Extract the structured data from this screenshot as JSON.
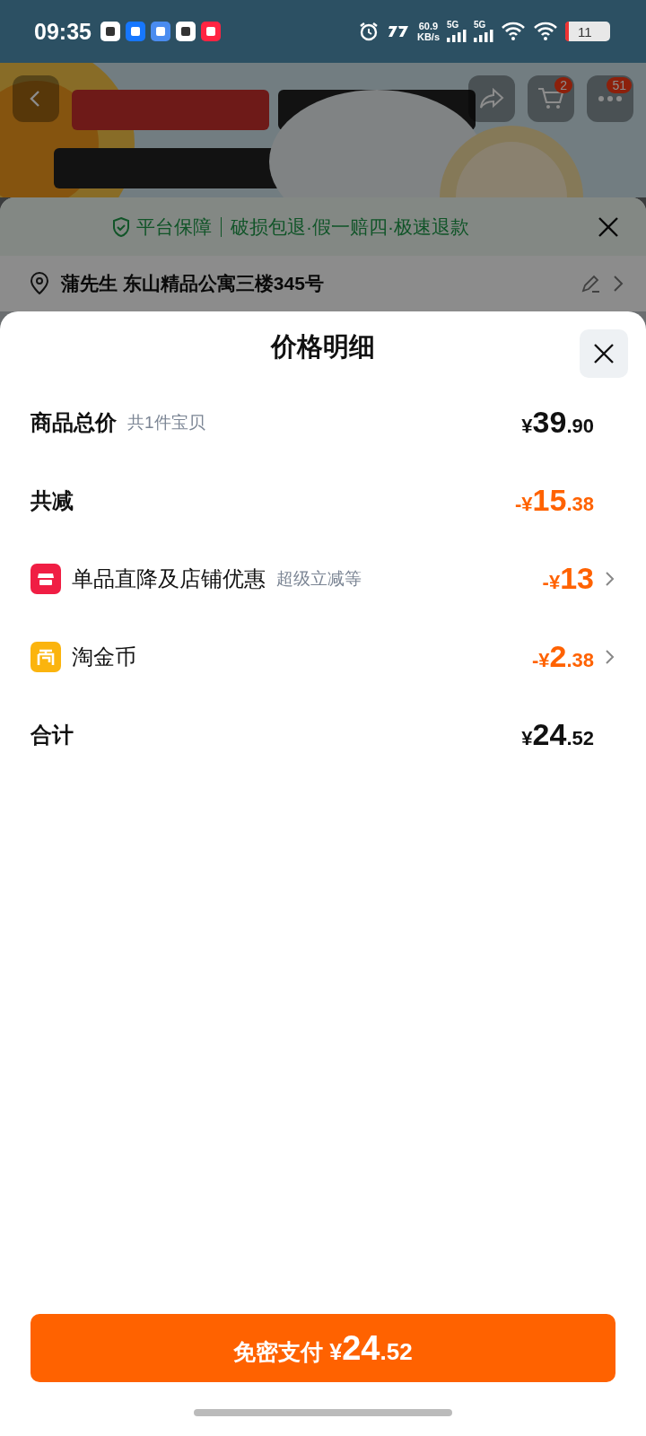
{
  "status_bar": {
    "time": "09:35",
    "speed": "60.9",
    "speed_unit": "KB/s",
    "networks": [
      "5G",
      "5G"
    ],
    "battery": "11"
  },
  "nav": {
    "cart_badge": "2",
    "more_badge": "51"
  },
  "guarantee": {
    "label": "平台保障",
    "text": "破损包退·假一赔四·极速退款"
  },
  "address": {
    "text": "蒲先生 东山精品公寓三楼345号"
  },
  "sheet": {
    "title": "价格明细",
    "rows": [
      {
        "kind": "plain",
        "label": "商品总价",
        "note": "共1件宝贝",
        "discount": false,
        "expandable": false,
        "amount": {
          "prefix": "¥",
          "main": "39",
          "fraction": ".90"
        }
      },
      {
        "kind": "plain",
        "label": "共减",
        "discount": true,
        "expandable": false,
        "amount": {
          "prefix": "-¥",
          "main": "15",
          "fraction": ".38"
        }
      },
      {
        "kind": "store",
        "label": "单品直降及店铺优惠",
        "note": "超级立减等",
        "discount": true,
        "expandable": true,
        "amount": {
          "prefix": "-¥",
          "main": "13"
        }
      },
      {
        "kind": "coin",
        "label": "淘金币",
        "discount": true,
        "expandable": true,
        "amount": {
          "prefix": "-¥",
          "main": "2",
          "fraction": ".38"
        }
      },
      {
        "kind": "plain",
        "label": "合计",
        "discount": false,
        "expandable": false,
        "amount": {
          "prefix": "¥",
          "main": "24",
          "fraction": ".52"
        }
      }
    ],
    "pay_button": {
      "label": "免密支付",
      "prefix": "¥",
      "main": "24",
      "fraction": ".52"
    }
  }
}
